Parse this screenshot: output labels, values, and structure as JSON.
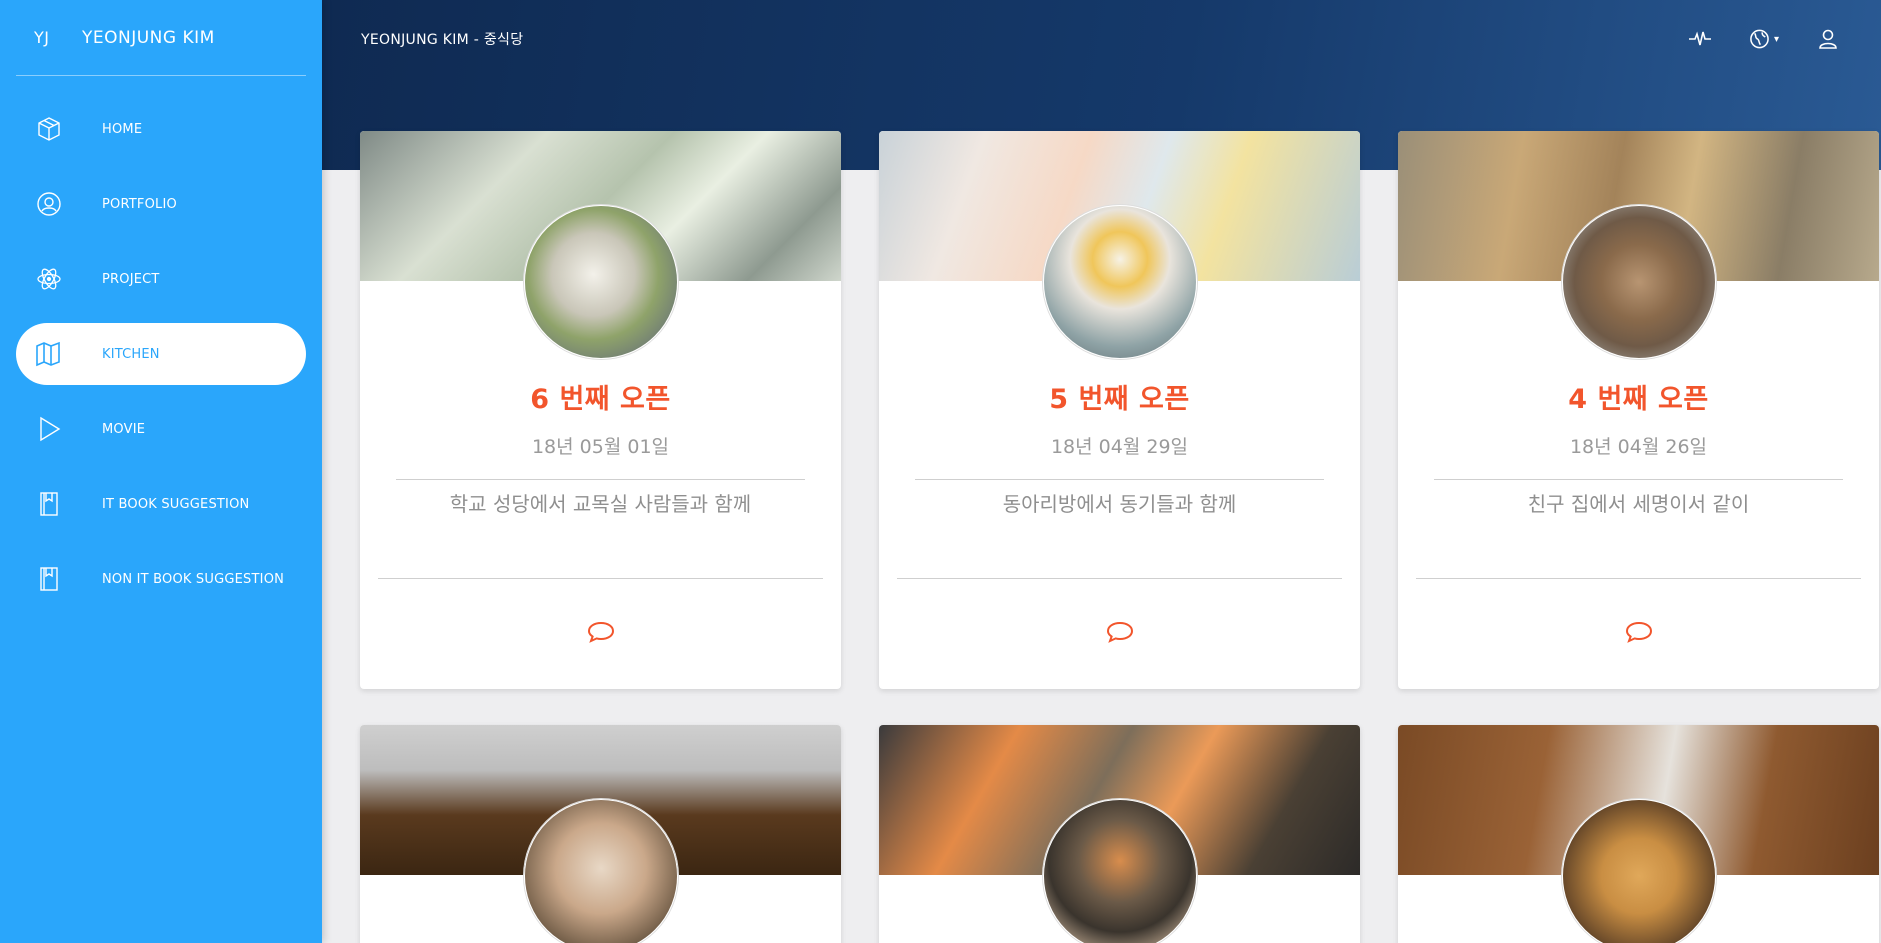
{
  "brand": {
    "mini": "YJ",
    "name": "YEONJUNG KIM"
  },
  "sidebar": {
    "items": [
      {
        "label": "HOME",
        "icon": "box-icon",
        "active": false
      },
      {
        "label": "PORTFOLIO",
        "icon": "user-circle-icon",
        "active": false
      },
      {
        "label": "PROJECT",
        "icon": "atom-icon",
        "active": false
      },
      {
        "label": "KITCHEN",
        "icon": "map-icon",
        "active": true
      },
      {
        "label": "MOVIE",
        "icon": "play-icon",
        "active": false
      },
      {
        "label": "IT BOOK SUGGESTION",
        "icon": "book-icon",
        "active": false
      },
      {
        "label": "NON IT BOOK SUGGESTION",
        "icon": "book-icon",
        "active": false
      }
    ]
  },
  "header": {
    "title": "YEONJUNG KIM - 중식당",
    "icons": [
      "activity-icon",
      "globe-icon",
      "user-icon"
    ]
  },
  "colors": {
    "sidebar": "#2aa6fb",
    "accent": "#f2552c",
    "header": "#15396a"
  },
  "cards": [
    {
      "title": "6 번째 오픈",
      "date": "18년 05월 01일",
      "description": "학교 성당에서 교목실 사람들과 함께",
      "icon": "comment-icon"
    },
    {
      "title": "5 번째 오픈",
      "date": "18년 04월 29일",
      "description": "동아리방에서 동기들과 함께",
      "icon": "comment-icon"
    },
    {
      "title": "4 번째 오픈",
      "date": "18년 04월 26일",
      "description": "친구 집에서 세명이서 같이",
      "icon": "comment-icon"
    },
    {
      "title": "",
      "date": "",
      "description": "",
      "icon": ""
    },
    {
      "title": "",
      "date": "",
      "description": "",
      "icon": ""
    },
    {
      "title": "",
      "date": "",
      "description": "",
      "icon": ""
    }
  ]
}
